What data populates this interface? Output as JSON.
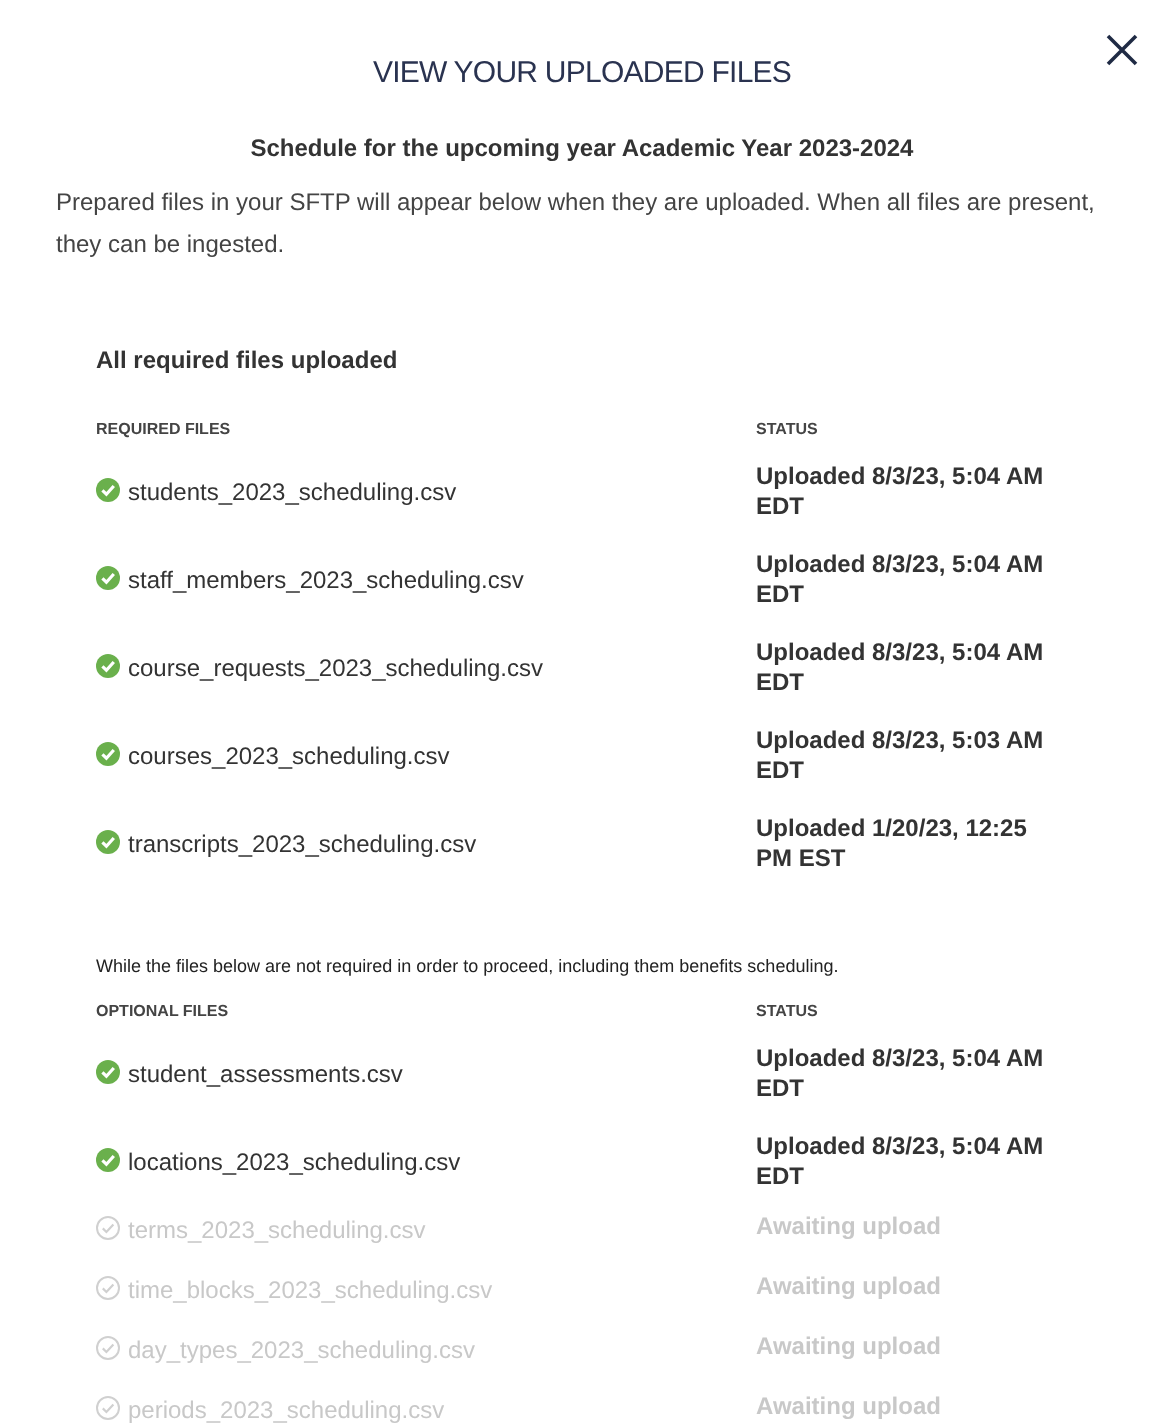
{
  "dialog": {
    "title": "VIEW YOUR UPLOADED FILES",
    "subtitle": "Schedule for the upcoming year Academic Year 2023-2024",
    "description": "Prepared files in your SFTP will appear below when they are uploaded. When all files are present, they can be ingested."
  },
  "required": {
    "summary": "All required files uploaded",
    "columns": [
      "REQUIRED FILES",
      "STATUS"
    ],
    "files": [
      {
        "name": "students_2023_scheduling.csv",
        "uploaded": true,
        "status": "Uploaded 8/3/23, 5:04 AM EDT"
      },
      {
        "name": "staff_members_2023_scheduling.csv",
        "uploaded": true,
        "status": "Uploaded 8/3/23, 5:04 AM EDT"
      },
      {
        "name": "course_requests_2023_scheduling.csv",
        "uploaded": true,
        "status": "Uploaded 8/3/23, 5:04 AM EDT"
      },
      {
        "name": "courses_2023_scheduling.csv",
        "uploaded": true,
        "status": "Uploaded 8/3/23, 5:03 AM EDT"
      },
      {
        "name": "transcripts_2023_scheduling.csv",
        "uploaded": true,
        "status": "Uploaded 1/20/23, 12:25 PM EST"
      }
    ]
  },
  "optional": {
    "note": "While the files below are not required in order to proceed, including them benefits scheduling.",
    "columns": [
      "OPTIONAL FILES",
      "STATUS"
    ],
    "files": [
      {
        "name": "student_assessments.csv",
        "uploaded": true,
        "status": "Uploaded 8/3/23, 5:04 AM EDT"
      },
      {
        "name": "locations_2023_scheduling.csv",
        "uploaded": true,
        "status": "Uploaded 8/3/23, 5:04 AM EDT"
      },
      {
        "name": "terms_2023_scheduling.csv",
        "uploaded": false,
        "status": "Awaiting upload"
      },
      {
        "name": "time_blocks_2023_scheduling.csv",
        "uploaded": false,
        "status": "Awaiting upload"
      },
      {
        "name": "day_types_2023_scheduling.csv",
        "uploaded": false,
        "status": "Awaiting upload"
      },
      {
        "name": "periods_2023_scheduling.csv",
        "uploaded": false,
        "status": "Awaiting upload"
      }
    ]
  }
}
